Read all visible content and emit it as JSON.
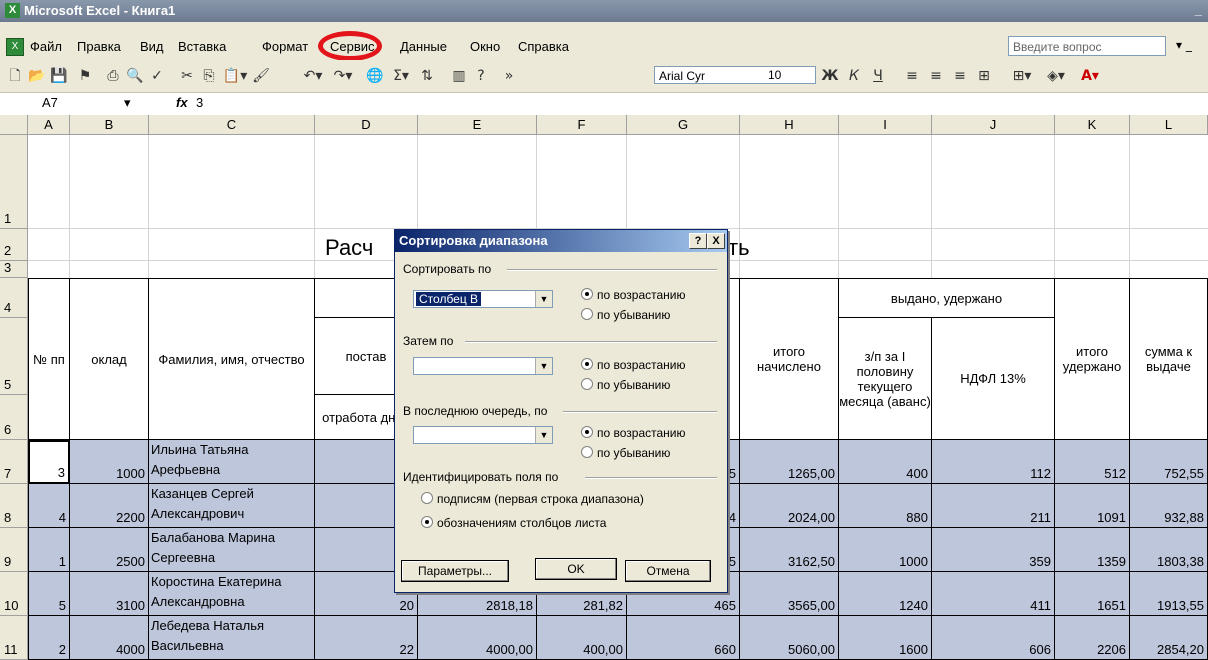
{
  "window": {
    "title": "Microsoft Excel - Книга1"
  },
  "menu": [
    "Файл",
    "Правка",
    "Вид",
    "Вставка",
    "Формат",
    "Сервис",
    "Данные",
    "Окно",
    "Справка"
  ],
  "ask_placeholder": "Введите вопрос",
  "toolbar": {
    "font": "Arial Cyr",
    "size": "10"
  },
  "formula": {
    "cell": "A7",
    "fx": "fx",
    "value": "3"
  },
  "columns": [
    "A",
    "B",
    "C",
    "D",
    "E",
    "F",
    "G",
    "H",
    "I",
    "J",
    "K",
    "L"
  ],
  "rows": [
    "1",
    "2",
    "3",
    "4",
    "5",
    "6",
    "7",
    "8",
    "9",
    "10",
    "11"
  ],
  "sheet": {
    "title_left": "Расч",
    "title_right": "ть",
    "hdr_issued": "выдано, удержано",
    "hdr_no": "№ пп",
    "hdr_salary": "оклад",
    "hdr_name": "Фамилия, имя, отчество",
    "hdr_rate": "постав",
    "hdr_worked": "отработа дней",
    "hdr_total_accr": "итого начислено",
    "hdr_advance": "з/п за I половину текущего месяца (аванс)",
    "hdr_ndfl": "НДФЛ 13%",
    "hdr_total_ded": "итого удержано",
    "hdr_pay": "сумма к выдаче",
    "data": [
      {
        "n": "3",
        "salary": "1000",
        "name1": "Ильина Татьяна",
        "name2": "Арефьевна",
        "d": "",
        "e": "",
        "f": "",
        "g": "55",
        "h": "1265,00",
        "i": "400",
        "j": "112",
        "k": "512",
        "l": "752,55"
      },
      {
        "n": "4",
        "salary": "2200",
        "name1": "Казанцев Сергей",
        "name2": "Александрович",
        "d": "",
        "e": "",
        "f": "",
        "g": "64",
        "h": "2024,00",
        "i": "880",
        "j": "211",
        "k": "1091",
        "l": "932,88"
      },
      {
        "n": "1",
        "salary": "2500",
        "name1": "Балабанова Марина",
        "name2": "Сергеевна",
        "d": "",
        "e": "",
        "f": "",
        "g": "5",
        "h": "3162,50",
        "i": "1000",
        "j": "359",
        "k": "1359",
        "l": "1803,38"
      },
      {
        "n": "5",
        "salary": "3100",
        "name1": "Коростина Екатерина",
        "name2": "Александровна",
        "d": "20",
        "e": "2818,18",
        "f": "281,82",
        "g": "465",
        "h": "3565,00",
        "i": "1240",
        "j": "411",
        "k": "1651",
        "l": "1913,55"
      },
      {
        "n": "2",
        "salary": "4000",
        "name1": "Лебедева Наталья",
        "name2": "Васильевна",
        "d": "22",
        "e": "4000,00",
        "f": "400,00",
        "g": "660",
        "h": "5060,00",
        "i": "1600",
        "j": "606",
        "k": "2206",
        "l": "2854,20"
      }
    ]
  },
  "dialog": {
    "title": "Сортировка диапазона",
    "help": "?",
    "close": "X",
    "sort_by": "Сортировать по",
    "sort_by_value": "Столбец B",
    "asc": "по возрастанию",
    "desc": "по убыванию",
    "then_by": "Затем по",
    "last_by": "В последнюю очередь, по",
    "identify": "Идентифицировать поля по",
    "by_labels": "подписям (первая строка диапазона)",
    "by_columns": "обозначениям столбцов листа",
    "params": "Параметры...",
    "ok": "OK",
    "cancel": "Отмена"
  }
}
